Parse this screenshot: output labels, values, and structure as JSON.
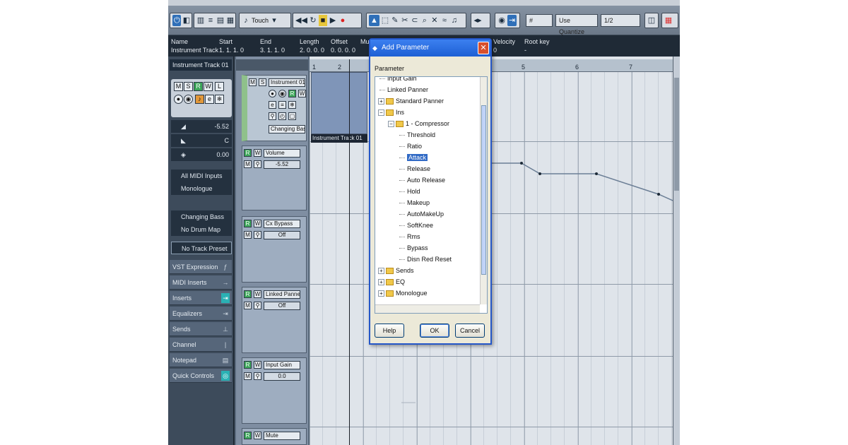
{
  "toolbar": {
    "touch_mode": "Touch",
    "grid_value": "1/2",
    "quantize_label": "Use Quantize",
    "tools": [
      "▲",
      "↔",
      "✎",
      "✂",
      "🔍",
      "✕",
      "≈",
      "♫"
    ]
  },
  "infoline": {
    "columns": [
      {
        "label": "Name",
        "value": "Instrument Track"
      },
      {
        "label": "Start",
        "value": "1. 1. 1. 0"
      },
      {
        "label": "End",
        "value": "3. 1. 1. 0"
      },
      {
        "label": "Length",
        "value": "2. 0. 0. 0"
      },
      {
        "label": "Offset",
        "value": "0. 0. 0. 0"
      },
      {
        "label": "Mute",
        "value": ""
      },
      {
        "label": "Velocity",
        "value": "0"
      },
      {
        "label": "Root key",
        "value": "-"
      }
    ]
  },
  "inspector": {
    "track_title": "Instrument Track 01",
    "volume": "-5.52",
    "pan": "C",
    "delay": "0.00",
    "midi_input": "All MIDI Inputs",
    "output": "Monologue",
    "bank": "Changing Bass",
    "program": "No Drum Map",
    "preset": "No Track Preset",
    "sections": [
      "VST Expression",
      "MIDI Inserts",
      "Inserts",
      "Equalizers",
      "Sends",
      "Channel",
      "Notepad",
      "Quick Controls"
    ]
  },
  "tracks": {
    "instrument": {
      "name": "Instrument 01",
      "bank": "Changing Bass"
    },
    "automation": [
      {
        "name": "Volume",
        "value": "-5.52"
      },
      {
        "name": "Cx Bypass",
        "value": "Off"
      },
      {
        "name": "Linked Panner",
        "value": "Off"
      },
      {
        "name": "Input Gain",
        "value": "0.0"
      },
      {
        "name": "Mute",
        "value": ""
      }
    ]
  },
  "arrange": {
    "ruler_ticks": [
      "1",
      "2",
      "5",
      "6",
      "7"
    ],
    "event_name": "Instrument Track 01"
  },
  "dialog": {
    "title": "Add Parameter",
    "list_label": "Parameter",
    "tree": [
      {
        "text": "Input Gain",
        "depth": 1,
        "kind": "leaf"
      },
      {
        "text": "Linked Panner",
        "depth": 1,
        "kind": "leaf"
      },
      {
        "text": "Standard Panner",
        "depth": 0,
        "kind": "folder-collapsed"
      },
      {
        "text": "Ins",
        "depth": 0,
        "kind": "folder-expanded"
      },
      {
        "text": "1 - Compressor",
        "depth": 1,
        "kind": "folder-expanded"
      },
      {
        "text": "Threshold",
        "depth": 2,
        "kind": "leaf"
      },
      {
        "text": "Ratio",
        "depth": 2,
        "kind": "leaf"
      },
      {
        "text": "Attack",
        "depth": 2,
        "kind": "leaf",
        "selected": true
      },
      {
        "text": "Release",
        "depth": 2,
        "kind": "leaf"
      },
      {
        "text": "Auto Release",
        "depth": 2,
        "kind": "leaf"
      },
      {
        "text": "Hold",
        "depth": 2,
        "kind": "leaf"
      },
      {
        "text": "Makeup",
        "depth": 2,
        "kind": "leaf"
      },
      {
        "text": "AutoMakeUp",
        "depth": 2,
        "kind": "leaf"
      },
      {
        "text": "SoftKnee",
        "depth": 2,
        "kind": "leaf"
      },
      {
        "text": "Rms",
        "depth": 2,
        "kind": "leaf"
      },
      {
        "text": "Bypass",
        "depth": 2,
        "kind": "leaf"
      },
      {
        "text": "Disn Red Reset",
        "depth": 2,
        "kind": "leaf"
      },
      {
        "text": "Sends",
        "depth": 0,
        "kind": "folder-collapsed"
      },
      {
        "text": "EQ",
        "depth": 0,
        "kind": "folder-collapsed"
      },
      {
        "text": "Monologue",
        "depth": 0,
        "kind": "folder-collapsed"
      }
    ],
    "buttons": {
      "help": "Help",
      "ok": "OK",
      "cancel": "Cancel"
    }
  },
  "colors": {
    "track_bg": "#9eadc0",
    "event": "#7f95b8",
    "automation_line": "#6c7f96",
    "selection": "#316ac5",
    "xp_title": "#2b6fe6"
  }
}
